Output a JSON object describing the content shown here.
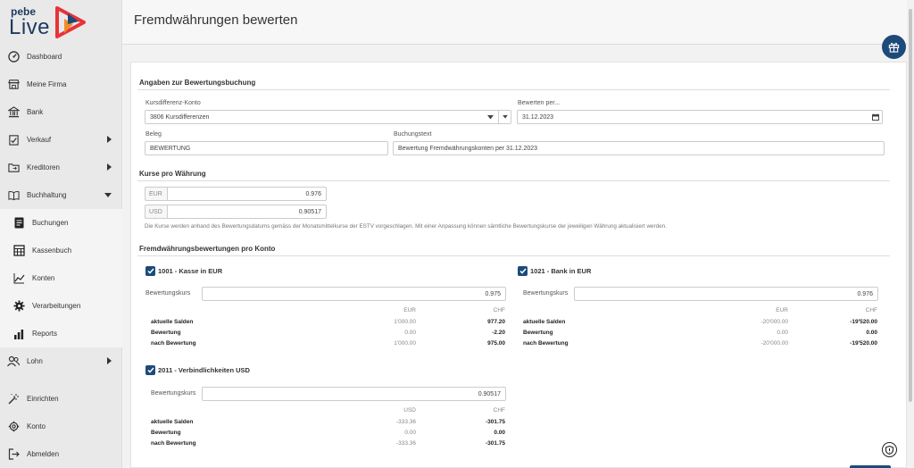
{
  "brand": {
    "pebe": "pebe",
    "live": "Live"
  },
  "sidebar": {
    "items": [
      {
        "label": "Dashboard",
        "icon": "dashboard-icon"
      },
      {
        "label": "Meine Firma",
        "icon": "store-icon"
      },
      {
        "label": "Bank",
        "icon": "bank-icon"
      },
      {
        "label": "Verkauf",
        "icon": "check-clipboard-icon"
      },
      {
        "label": "Kreditoren",
        "icon": "folder-icon"
      },
      {
        "label": "Buchhaltung",
        "icon": "book-icon"
      }
    ],
    "sub_items": [
      {
        "label": "Buchungen",
        "icon": "document-icon"
      },
      {
        "label": "Kassenbuch",
        "icon": "ledger-icon"
      },
      {
        "label": "Konten",
        "icon": "chart-line-icon"
      },
      {
        "label": "Verarbeitungen",
        "icon": "gear-icon"
      },
      {
        "label": "Reports",
        "icon": "bar-chart-icon"
      }
    ],
    "lohn": {
      "label": "Lohn",
      "icon": "people-icon"
    },
    "bottom": [
      {
        "label": "Einrichten",
        "icon": "magic-wand-icon"
      },
      {
        "label": "Konto",
        "icon": "account-gear-icon"
      },
      {
        "label": "Abmelden",
        "icon": "logout-icon"
      }
    ]
  },
  "header": {
    "title": "Fremdwährungen bewerten"
  },
  "booking": {
    "section_title": "Angaben zur Bewertungsbuchung",
    "konto_label": "Kursdifferenz-Konto",
    "konto_value": "3806 Kursdifferenzen",
    "datum_label": "Bewerten per...",
    "datum_value": "31.12.2023",
    "beleg_label": "Beleg",
    "beleg_value": "BEWERTUNG",
    "text_label": "Buchungstext",
    "text_value": "Bewertung Fremdwährungskonten per 31.12.2023"
  },
  "rates": {
    "section_title": "Kurse pro Währung",
    "items": [
      {
        "currency": "EUR",
        "value": "0.976"
      },
      {
        "currency": "USD",
        "value": "0.90517"
      }
    ],
    "note": "Die Kurse werden anhand des Bewertungsdatums gemäss der Monatsmittelkurse der ESTV vorgeschlagen. Mit einer Anpassung können sämtliche Bewertungskurse der jeweiligen Währung aktualisiert werden."
  },
  "accounts": {
    "section_title": "Fremdwährungsbewertungen pro Konto",
    "rate_label": "Bewertungskurs",
    "row_labels": [
      "aktuelle Salden",
      "Bewertung",
      "nach Bewertung"
    ],
    "list": [
      {
        "title": "1001 - Kasse in EUR",
        "rate": "0.975",
        "cur": "EUR",
        "base": "CHF",
        "fx": [
          "1'000.00",
          "0.00",
          "1'000.00"
        ],
        "chf": [
          "977.20",
          "-2.20",
          "975.00"
        ]
      },
      {
        "title": "1021 - Bank in EUR",
        "rate": "0.976",
        "cur": "EUR",
        "base": "CHF",
        "fx": [
          "-20'000.00",
          "0.00",
          "-20'000.00"
        ],
        "chf": [
          "-19'520.00",
          "0.00",
          "-19'520.00"
        ]
      },
      {
        "title": "2011 - Verbindlichkeiten USD",
        "rate": "0.90517",
        "cur": "USD",
        "base": "CHF",
        "fx": [
          "-333.36",
          "0.00",
          "-333.36"
        ],
        "chf": [
          "-301.75",
          "0.00",
          "-301.75"
        ]
      }
    ]
  },
  "colors": {
    "accent": "#1e4a7a",
    "sidebar_bg": "#e9e9e9"
  }
}
